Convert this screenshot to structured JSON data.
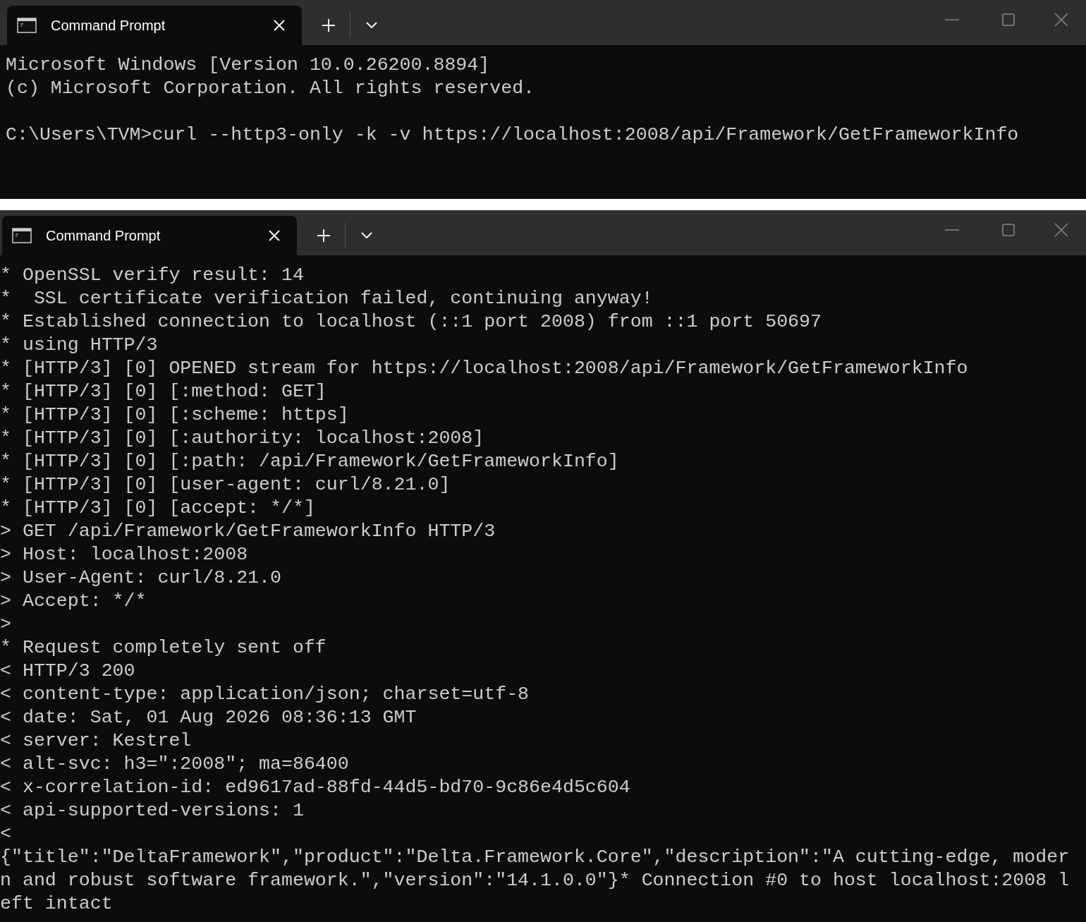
{
  "windows": [
    {
      "tab": {
        "title": "Command Prompt",
        "selected": true
      },
      "blocks": [
        [
          "Microsoft Windows [Version 10.0.26200.8894]",
          "(c) Microsoft Corporation. All rights reserved."
        ],
        [
          "C:\\Users\\TVM>curl --http3-only -k -v https://localhost:2008/api/Framework/GetFrameworkInfo"
        ]
      ]
    },
    {
      "tab": {
        "title": "Command Prompt",
        "selected": true
      },
      "blocks": [
        [
          "* OpenSSL verify result: 14",
          "*  SSL certificate verification failed, continuing anyway!",
          "* Established connection to localhost (::1 port 2008) from ::1 port 50697",
          "* using HTTP/3",
          "* [HTTP/3] [0] OPENED stream for https://localhost:2008/api/Framework/GetFrameworkInfo",
          "* [HTTP/3] [0] [:method: GET]",
          "* [HTTP/3] [0] [:scheme: https]",
          "* [HTTP/3] [0] [:authority: localhost:2008]",
          "* [HTTP/3] [0] [:path: /api/Framework/GetFrameworkInfo]",
          "* [HTTP/3] [0] [user-agent: curl/8.21.0]",
          "* [HTTP/3] [0] [accept: */*]",
          "> GET /api/Framework/GetFrameworkInfo HTTP/3",
          "> Host: localhost:2008",
          "> User-Agent: curl/8.21.0",
          "> Accept: */*",
          ">",
          "* Request completely sent off",
          "< HTTP/3 200",
          "< content-type: application/json; charset=utf-8",
          "< date: Sat, 01 Aug 2026 08:36:13 GMT",
          "< server: Kestrel",
          "< alt-svc: h3=\":2008\"; ma=86400",
          "< x-correlation-id: ed9617ad-88fd-44d5-bd70-9c86e4d5c604",
          "< api-supported-versions: 1",
          "<",
          "{\"title\":\"DeltaFramework\",\"product\":\"Delta.Framework.Core\",\"description\":\"A cutting-edge, moder",
          "n and robust software framework.\",\"version\":\"14.1.0.0\"}* Connection #0 to host localhost:2008 l",
          "eft intact"
        ]
      ]
    }
  ]
}
